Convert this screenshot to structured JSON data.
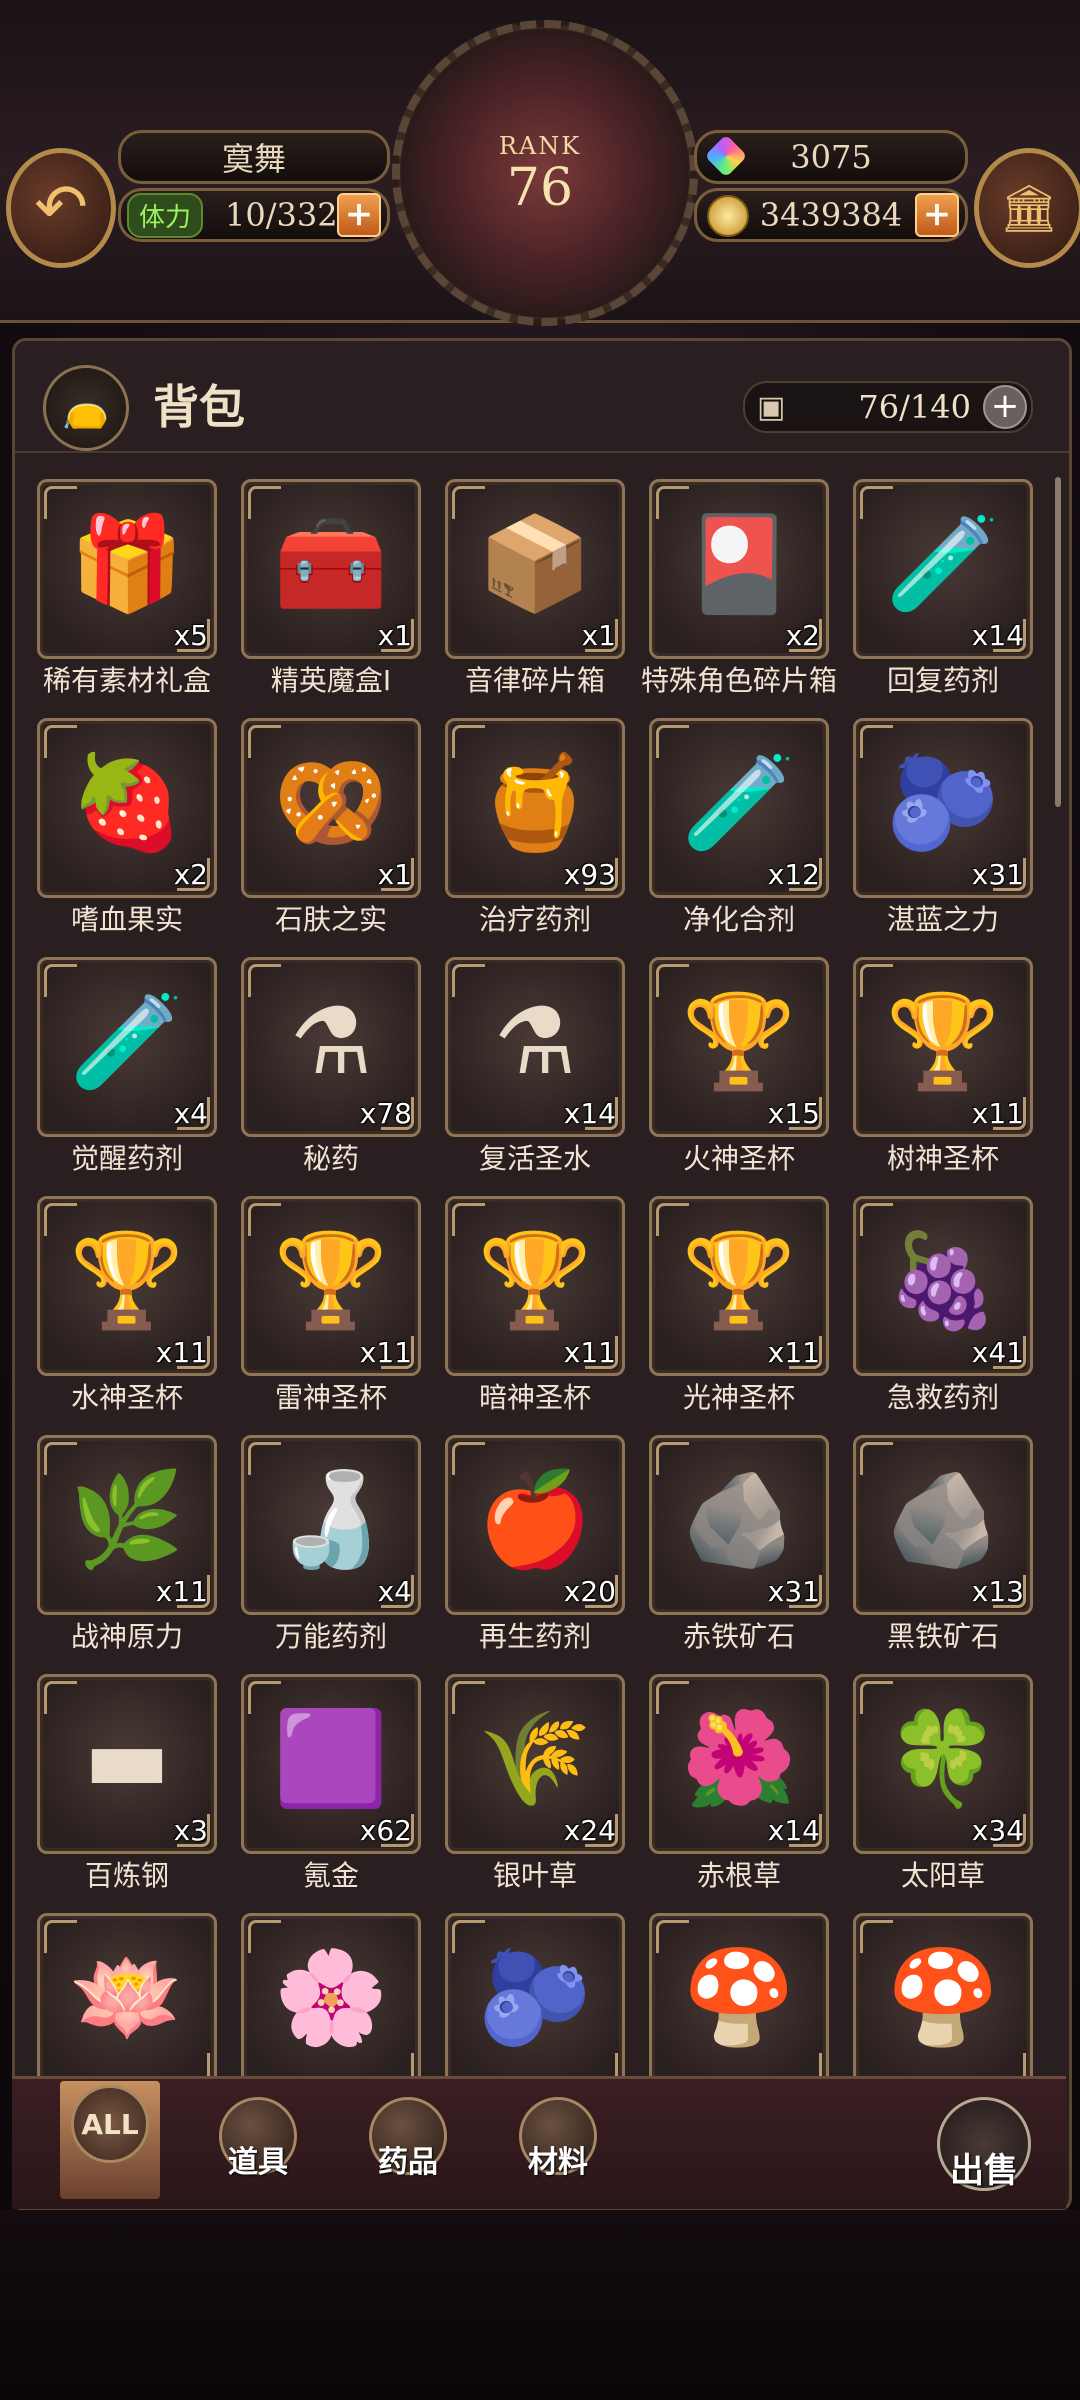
{
  "header": {
    "player_name": "寞舞",
    "stamina_label": "体力",
    "stamina_value": "10/332",
    "rank_label": "RANK",
    "rank_value": "76",
    "gems": "3075",
    "gold": "3439384"
  },
  "bag": {
    "title": "背包",
    "capacity": "76/140"
  },
  "items": [
    {
      "name": "稀有素材礼盒",
      "qty": "x5",
      "icon": "gift-bundle-icon",
      "glyph": "🎁"
    },
    {
      "name": "精英魔盒Ⅰ",
      "qty": "x1",
      "icon": "silver-chest-icon",
      "glyph": "🧰"
    },
    {
      "name": "音律碎片箱",
      "qty": "x1",
      "icon": "blue-chest-icon",
      "glyph": "📦"
    },
    {
      "name": "特殊角色碎片箱",
      "qty": "x2",
      "icon": "golden-chest-icon",
      "glyph": "🎴"
    },
    {
      "name": "回复药剂",
      "qty": "x14",
      "icon": "green-potion-icon",
      "glyph": "🧪"
    },
    {
      "name": "嗜血果实",
      "qty": "x2",
      "icon": "red-fruit-icon",
      "glyph": "🍓"
    },
    {
      "name": "石肤之实",
      "qty": "x1",
      "icon": "brown-nut-icon",
      "glyph": "🥨"
    },
    {
      "name": "治疗药剂",
      "qty": "x93",
      "icon": "yellow-potion-icon",
      "glyph": "🍯"
    },
    {
      "name": "净化合剂",
      "qty": "x12",
      "icon": "test-tube-icon",
      "glyph": "🧪"
    },
    {
      "name": "湛蓝之力",
      "qty": "x31",
      "icon": "blue-berry-icon",
      "glyph": "🫐"
    },
    {
      "name": "觉醒药剂",
      "qty": "x4",
      "icon": "yellow-vial-icon",
      "glyph": "🧪"
    },
    {
      "name": "秘药",
      "qty": "x78",
      "icon": "green-flask-icon",
      "glyph": "⚗"
    },
    {
      "name": "复活圣水",
      "qty": "x14",
      "icon": "ornate-flask-icon",
      "glyph": "⚗"
    },
    {
      "name": "火神圣杯",
      "qty": "x15",
      "icon": "red-chalice-icon",
      "glyph": "🏆"
    },
    {
      "name": "树神圣杯",
      "qty": "x11",
      "icon": "green-chalice-icon",
      "glyph": "🏆"
    },
    {
      "name": "水神圣杯",
      "qty": "x11",
      "icon": "blue-chalice-icon",
      "glyph": "🏆"
    },
    {
      "name": "雷神圣杯",
      "qty": "x11",
      "icon": "gold-chalice-icon",
      "glyph": "🏆"
    },
    {
      "name": "暗神圣杯",
      "qty": "x11",
      "icon": "purple-chalice-icon",
      "glyph": "🏆"
    },
    {
      "name": "光神圣杯",
      "qty": "x11",
      "icon": "silver-chalice-icon",
      "glyph": "🏆"
    },
    {
      "name": "急救药剂",
      "qty": "x41",
      "icon": "purple-potion-icon",
      "glyph": "🍇"
    },
    {
      "name": "战神原力",
      "qty": "x11",
      "icon": "cotton-branch-icon",
      "glyph": "🌿"
    },
    {
      "name": "万能药剂",
      "qty": "x4",
      "icon": "white-potion-icon",
      "glyph": "🍶"
    },
    {
      "name": "再生药剂",
      "qty": "x20",
      "icon": "red-potion-icon",
      "glyph": "🍎"
    },
    {
      "name": "赤铁矿石",
      "qty": "x31",
      "icon": "red-ore-icon",
      "glyph": "🪨"
    },
    {
      "name": "黑铁矿石",
      "qty": "x13",
      "icon": "black-ore-icon",
      "glyph": "🪨"
    },
    {
      "name": "百炼钢",
      "qty": "x3",
      "icon": "steel-bar-icon",
      "glyph": "▬"
    },
    {
      "name": "氪金",
      "qty": "x62",
      "icon": "purple-ingot-icon",
      "glyph": "🟪"
    },
    {
      "name": "银叶草",
      "qty": "x24",
      "icon": "silver-leaf-icon",
      "glyph": "🌾"
    },
    {
      "name": "赤根草",
      "qty": "x14",
      "icon": "red-herb-icon",
      "glyph": "🌺"
    },
    {
      "name": "太阳草",
      "qty": "x34",
      "icon": "white-clover-icon",
      "glyph": "🍀"
    },
    {
      "name": "",
      "qty": "",
      "icon": "white-lotus-icon",
      "glyph": "🪷"
    },
    {
      "name": "",
      "qty": "",
      "icon": "rainbow-lotus-icon",
      "glyph": "🌸"
    },
    {
      "name": "",
      "qty": "",
      "icon": "blue-plum-icon",
      "glyph": "🫐"
    },
    {
      "name": "",
      "qty": "",
      "icon": "purple-mushroom-icon",
      "glyph": "🍄"
    },
    {
      "name": "",
      "qty": "",
      "icon": "blue-mushroom-icon",
      "glyph": "🍄"
    }
  ],
  "tabs": [
    {
      "label": "ALL"
    },
    {
      "label": "道具"
    },
    {
      "label": "药品"
    },
    {
      "label": "材料"
    }
  ],
  "sell_label": "出售"
}
